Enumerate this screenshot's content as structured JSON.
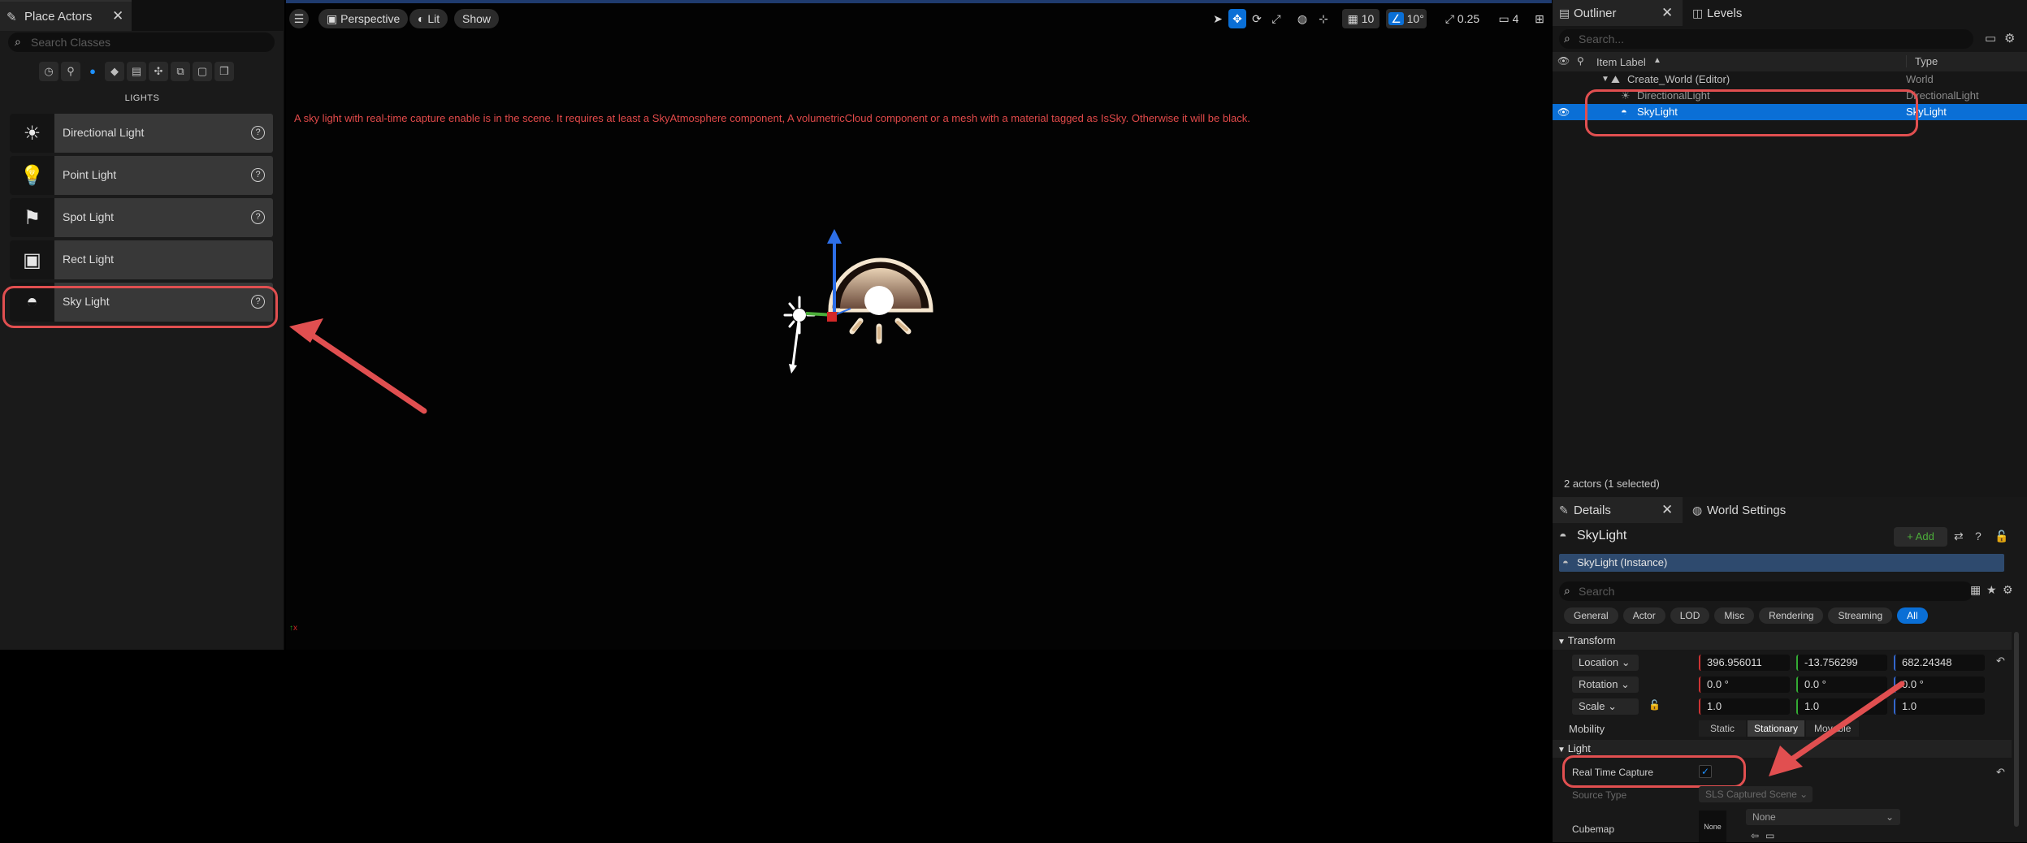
{
  "left_panel": {
    "tab_title": "Place Actors",
    "search_placeholder": "Search Classes",
    "category_label": "LIGHTS",
    "items": [
      {
        "label": "Directional Light",
        "icon": "directional-light-icon"
      },
      {
        "label": "Point Light",
        "icon": "point-light-icon"
      },
      {
        "label": "Spot Light",
        "icon": "spot-light-icon"
      },
      {
        "label": "Rect Light",
        "icon": "rect-light-icon"
      },
      {
        "label": "Sky Light",
        "icon": "sky-light-icon"
      }
    ]
  },
  "viewport": {
    "perspective_label": "Perspective",
    "lit_label": "Lit",
    "show_label": "Show",
    "grid_snap": "10",
    "angle_snap": "10°",
    "scale_snap": "0.25",
    "camera_speed": "4",
    "warning": "A sky light with real-time capture enable is in the scene. It requires at least a SkyAtmosphere component, A volumetricCloud component or a mesh with a material tagged as IsSky. Otherwise it will be black."
  },
  "outliner": {
    "tab_label": "Outliner",
    "levels_tab_label": "Levels",
    "search_placeholder": "Search...",
    "col_item_label": "Item Label",
    "col_type": "Type",
    "rows": [
      {
        "label": "Create_World (Editor)",
        "type": "World"
      },
      {
        "label": "DirectionalLight",
        "type": "DirectionalLight"
      },
      {
        "label": "SkyLight",
        "type": "SkyLight"
      }
    ],
    "status": "2 actors (1 selected)"
  },
  "details": {
    "tab_label": "Details",
    "world_settings_label": "World Settings",
    "actor_name": "SkyLight",
    "add_label": "+ Add",
    "component_label": "SkyLight (Instance)",
    "search_placeholder": "Search",
    "filters": [
      "General",
      "Actor",
      "LOD",
      "Misc",
      "Rendering",
      "Streaming",
      "All"
    ],
    "transform_section": "Transform",
    "location_label": "Location",
    "location": [
      "396.956011",
      "-13.756299",
      "682.24348"
    ],
    "rotation_label": "Rotation",
    "rotation": [
      "0.0 °",
      "0.0 °",
      "0.0 °"
    ],
    "scale_label": "Scale",
    "scale": [
      "1.0",
      "1.0",
      "1.0"
    ],
    "mobility_label": "Mobility",
    "mobility_options": [
      "Static",
      "Stationary",
      "Movable"
    ],
    "light_section": "Light",
    "real_time_capture_label": "Real Time Capture",
    "source_type_label": "Source Type",
    "source_type_value": "SLS Captured Scene",
    "cubemap_label": "Cubemap",
    "cubemap_thumb": "None",
    "cubemap_value": "None"
  }
}
